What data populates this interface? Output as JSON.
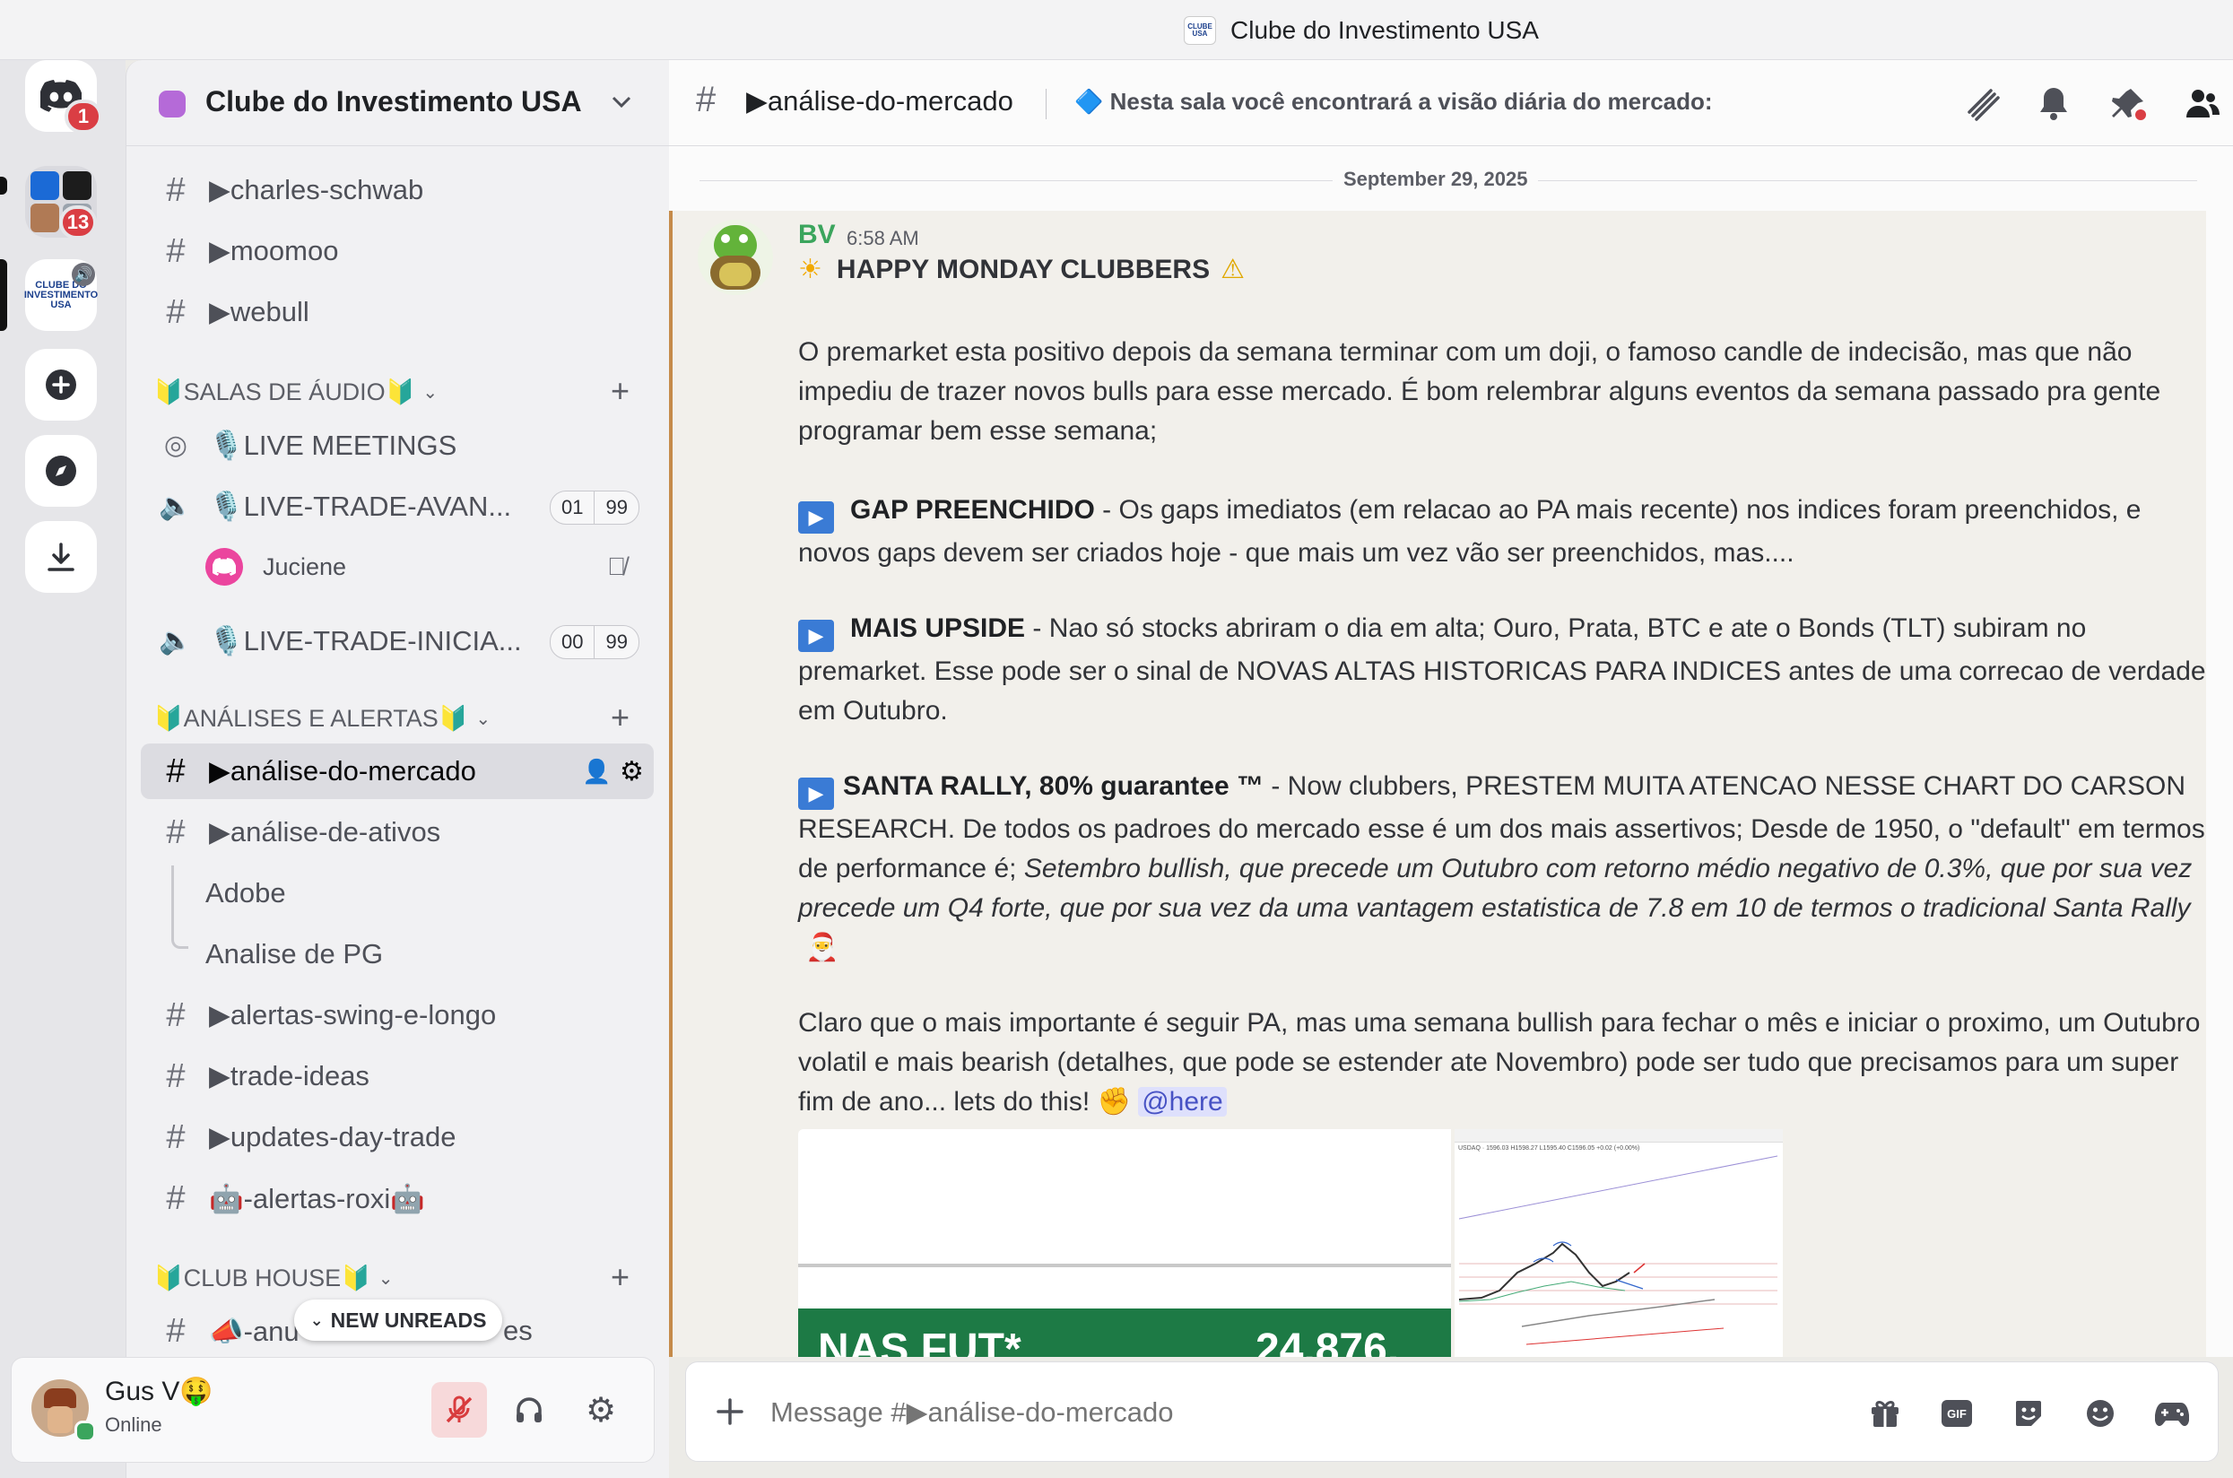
{
  "window": {
    "title": "Clube do Investimento USA"
  },
  "rail": {
    "dm_badge": "1",
    "folder_badge": "13",
    "server_logo_text": "CLUBE DO INVESTIMENTO USA"
  },
  "server": {
    "name": "Clube do Investimento USA"
  },
  "channels_top": [
    {
      "label": "▶charles-schwab"
    },
    {
      "label": "▶moomoo"
    },
    {
      "label": "▶webull"
    }
  ],
  "categories": {
    "audio": "🔰SALAS DE ÁUDIO🔰",
    "analises": "🔰ANÁLISES E ALERTAS🔰",
    "club": "🔰CLUB HOUSE🔰"
  },
  "voice": [
    {
      "label": "🎙️LIVE MEETINGS"
    },
    {
      "label": "🎙️LIVE-TRADE-AVAN...",
      "count": "01",
      "limit": "99"
    },
    {
      "label": "🎙️LIVE-TRADE-INICIA...",
      "count": "00",
      "limit": "99"
    }
  ],
  "voice_user": {
    "name": "Juciene"
  },
  "analises": [
    {
      "label": "▶análise-do-mercado"
    },
    {
      "label": "▶análise-de-ativos"
    }
  ],
  "threads": [
    "Adobe",
    "Analise de PG"
  ],
  "more_channels": [
    {
      "label": "▶alertas-swing-e-longo"
    },
    {
      "label": "▶trade-ideas"
    },
    {
      "label": "▶updates-day-trade"
    },
    {
      "label": "🤖-alertas-roxi🤖"
    }
  ],
  "partial_channel": {
    "label_a": "📣-anu",
    "label_b": "es"
  },
  "new_unreads": "NEW UNREADS",
  "user": {
    "name": "Gus V🤑",
    "status": "Online"
  },
  "channel_header": {
    "name": "▶análise-do-mercado",
    "topic": "🔷 Nesta sala você encontrará a visão diária do mercado: índices principais, s..."
  },
  "divider_date": "September 29, 2025",
  "message": {
    "author": "BV",
    "time": "6:58 AM",
    "headline": "HAPPY MONDAY CLUBBERS",
    "p1": "O premarket esta positivo depois da semana terminar com um doji, o famoso candle de indecisão, mas que não impediu de trazer novos bulls para esse mercado. É bom relembrar alguns eventos da semana passado pra gente programar bem esse semana;",
    "gap_title": "GAP PREENCHIDO",
    "gap_text": " - Os gaps imediatos (em relacao ao PA mais recente) nos indices foram preenchidos, e novos gaps devem ser criados hoje - que mais um vez vão ser preenchidos, mas....",
    "upside_title": "MAIS UPSIDE",
    "upside_text": " - Nao só stocks abriram o dia em alta; Ouro, Prata, BTC e ate o Bonds (TLT)  subiram no premarket. Esse pode ser o sinal de NOVAS ALTAS HISTORICAS PARA INDICES antes de uma correcao de verdade em Outubro.",
    "santa_title": "SANTA RALLY, 80% guarantee ™",
    "santa_text": " - Now clubbers, PRESTEM MUITA ATENCAO NESSE CHART DO CARSON RESEARCH. De todos os padroes do mercado esse é um dos mais assertivos;  Desde de 1950, o \"default\" em termos de performance é; ",
    "santa_italic": "Setembro bullish, que precede um Outubro com retorno médio negativo de 0.3%, que por sua vez precede um Q4 forte, que por sua vez da uma vantagem estatistica de 7.8 em 10 de termos o tradicional Santa Rally",
    "p5": "Claro que o mais importante é seguir PA, mas uma semana bullish para fechar o mês e iniciar o proximo, um Outubro volatil e mais bearish (detalhes, que pode se estender ate Novembro) pode ser tudo que precisamos para um super fim de ano... lets do this! ",
    "mention": "@here",
    "attachment_text": "NAS FUT*",
    "attachment_value": "24,876.",
    "chart_header": "USDAQ · 1596.03 H1598.27 L1595.40 C1596.05 +0.02 (+0.00%)"
  },
  "composer": {
    "placeholder": "Message #▶análise-do-mercado"
  },
  "colors": {
    "accent": "#5865f2",
    "author": "#3ba55d",
    "badge": "#da3e44",
    "mention_bg": "#dee0fc"
  }
}
